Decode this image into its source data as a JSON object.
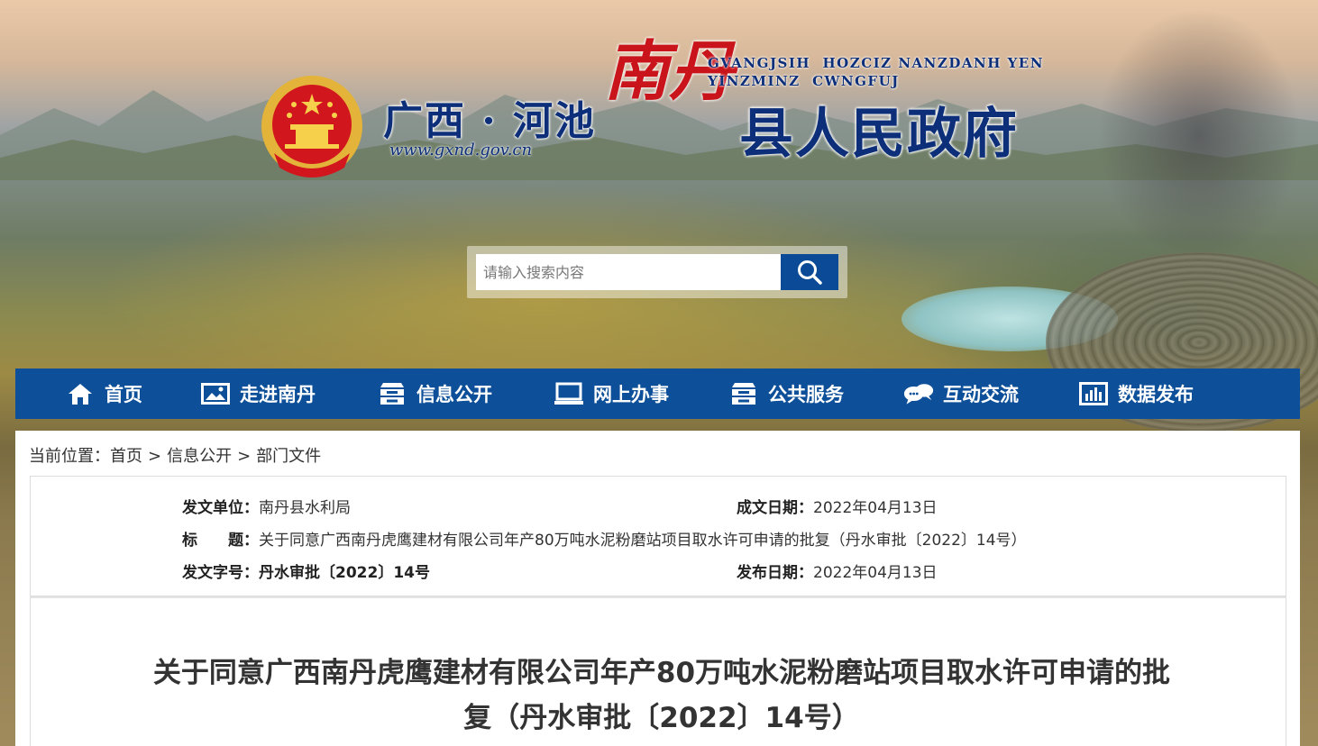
{
  "header": {
    "region": "广西 · 河池",
    "url": "www.gxnd.gov.cn",
    "county_calligraphy": "南丹",
    "zhuang_line1": "GVANGJSIH  HOZCIZ NANZDANH YEN",
    "zhuang_line2": "YINZMINZ  CWNGFUJ",
    "title": "县人民政府"
  },
  "search": {
    "placeholder": "请输入搜索内容",
    "icon": "search-icon"
  },
  "nav": {
    "items": [
      {
        "label": "首页",
        "icon": "home-icon"
      },
      {
        "label": "走进南丹",
        "icon": "picture-icon"
      },
      {
        "label": "信息公开",
        "icon": "list-icon"
      },
      {
        "label": "网上办事",
        "icon": "monitor-icon"
      },
      {
        "label": "公共服务",
        "icon": "list-icon"
      },
      {
        "label": "互动交流",
        "icon": "chat-icon"
      },
      {
        "label": "数据发布",
        "icon": "bar-chart-icon"
      }
    ]
  },
  "breadcrumb": {
    "prefix": "当前位置：",
    "items": [
      "首页",
      "信息公开",
      "部门文件"
    ],
    "separator": ">"
  },
  "meta": {
    "issuer_label": "发文单位：",
    "issuer": "南丹县水利局",
    "created_label": "成文日期：",
    "created": "2022年04月13日",
    "title_label": "标　　题：",
    "title": "关于同意广西南丹虎鹰建材有限公司年产80万吨水泥粉磨站项目取水许可申请的批复（丹水审批〔2022〕14号）",
    "doc_no_label": "发文字号：",
    "doc_no": "丹水审批〔2022〕14号",
    "published_label": "发布日期：",
    "published": "2022年04月13日"
  },
  "article": {
    "title_line1": "关于同意广西南丹虎鹰建材有限公司年产80万吨水泥粉磨站项目取水许可申请的批",
    "title_line2": "复（丹水审批〔2022〕14号）"
  },
  "colors": {
    "nav_bg": "#0d4f98",
    "brand_blue": "#0d2f7a",
    "brand_red": "#c8141a",
    "search_button": "#0b4a96"
  }
}
